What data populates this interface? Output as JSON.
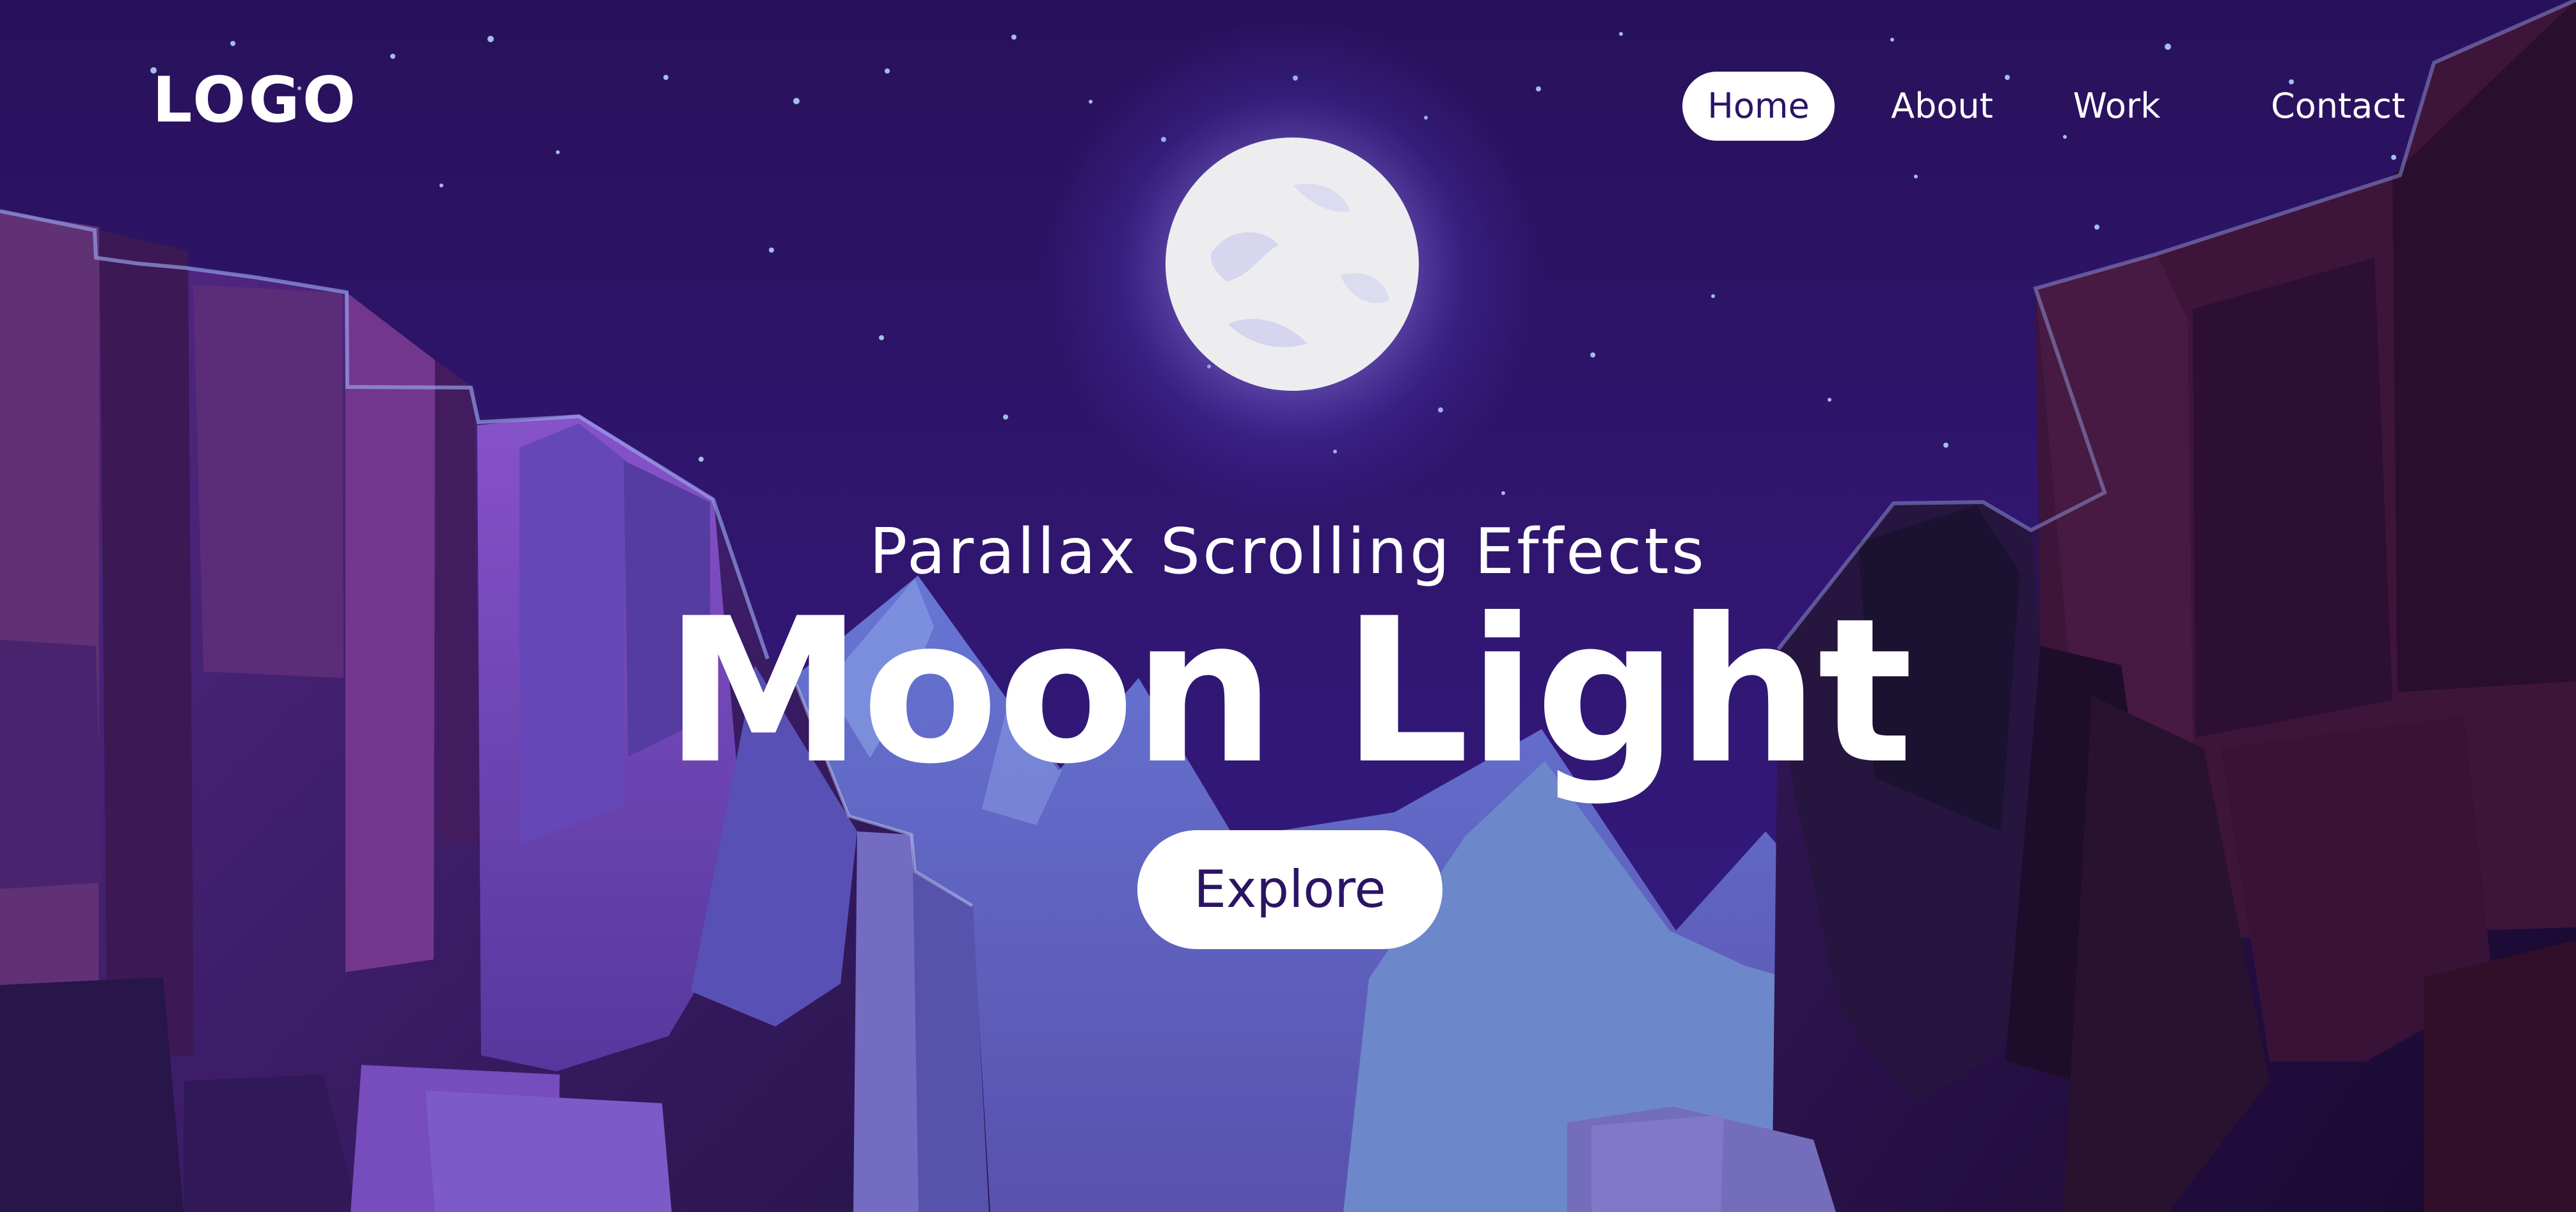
{
  "header": {
    "logo": "LOGO",
    "nav": [
      "Home",
      "About",
      "Work",
      "Contact"
    ],
    "active_nav": "Home"
  },
  "hero": {
    "subtitle": "Parallax Scrolling Effects",
    "title": "Moon Light",
    "cta": "Explore"
  },
  "colors": {
    "sky": "#2b1464",
    "moon_glow": "#6f5cff",
    "mountains": "#6f8dd8",
    "cliffs": "#4a2a7a",
    "text": "#ffffff"
  }
}
